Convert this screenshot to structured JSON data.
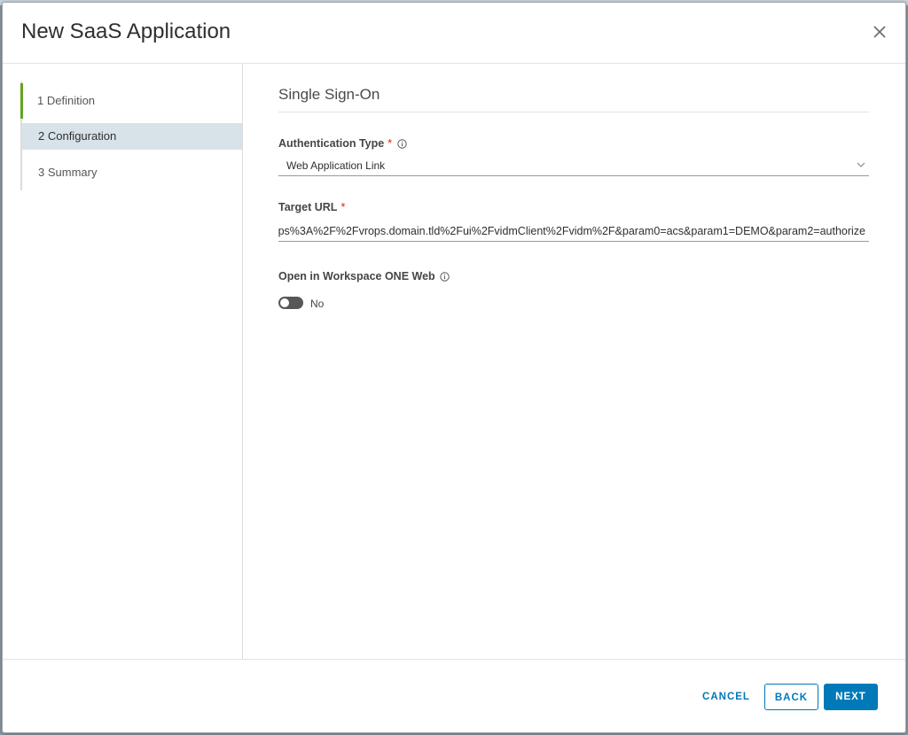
{
  "modal": {
    "title": "New SaaS Application"
  },
  "steps": [
    {
      "label": "1 Definition",
      "state": "done"
    },
    {
      "label": "2 Configuration",
      "state": "active"
    },
    {
      "label": "3 Summary",
      "state": "todo"
    }
  ],
  "section": {
    "title": "Single Sign-On"
  },
  "auth_type": {
    "label": "Authentication Type",
    "required_mark": "*",
    "value": "Web Application Link"
  },
  "target_url": {
    "label": "Target URL",
    "required_mark": "*",
    "value": "ps%3A%2F%2Fvrops.domain.tld%2Fui%2FvidmClient%2Fvidm%2F&param0=acs&param1=DEMO&param2=authorize"
  },
  "workspace_web": {
    "label": "Open in Workspace ONE Web",
    "toggle_state": "No",
    "enabled": false
  },
  "footer": {
    "cancel": "CANCEL",
    "back": "BACK",
    "next": "NEXT"
  },
  "colors": {
    "accent": "#0079b8",
    "step_done": "#62a420",
    "step_active_bg": "#d8e3e9",
    "required": "#e12200"
  }
}
